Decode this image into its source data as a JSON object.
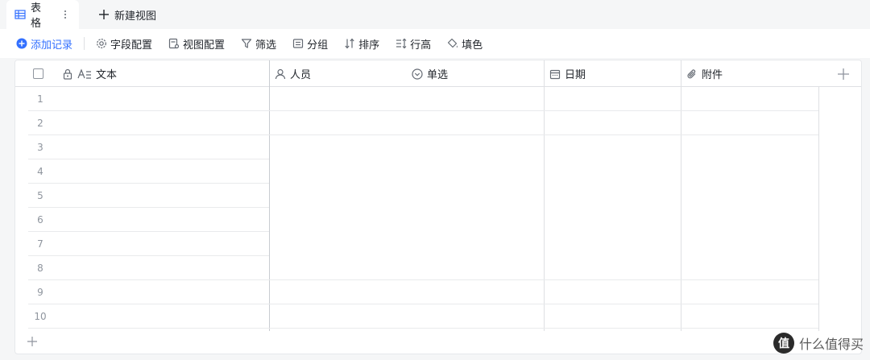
{
  "tabs": {
    "active_label": "表格",
    "new_view_label": "新建视图"
  },
  "toolbar": {
    "add_record": "添加记录",
    "field_config": "字段配置",
    "view_config": "视图配置",
    "filter": "筛选",
    "group": "分组",
    "sort": "排序",
    "row_height": "行高",
    "fill_color": "填色"
  },
  "columns": [
    {
      "label": "文本",
      "icon": "text-field-icon"
    },
    {
      "label": "人员",
      "icon": "person-icon"
    },
    {
      "label": "单选",
      "icon": "single-select-icon"
    },
    {
      "label": "日期",
      "icon": "calendar-icon"
    },
    {
      "label": "附件",
      "icon": "attachment-icon"
    }
  ],
  "rows": [
    "1",
    "2",
    "3",
    "4",
    "5",
    "6",
    "7",
    "8",
    "9",
    "10"
  ],
  "watermark": {
    "text": "什么值得买",
    "logo": "值"
  },
  "colors": {
    "accent": "#3370ff",
    "border": "#dee0e3"
  }
}
